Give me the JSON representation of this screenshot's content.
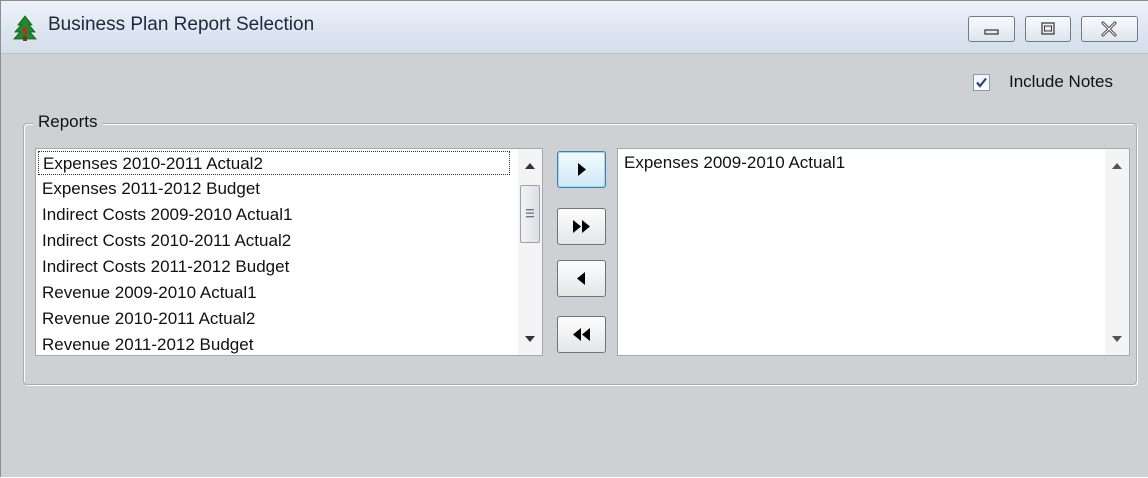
{
  "window": {
    "title": "Business Plan Report Selection",
    "icon": "tree-dollar-icon",
    "caption_buttons": [
      "minimize-icon",
      "restore-icon",
      "close-icon"
    ]
  },
  "options": {
    "include_notes_label": "Include Notes",
    "include_notes_checked": true
  },
  "reports_group": {
    "label": "Reports",
    "available": [
      "Expenses  2010-2011 Actual2",
      "Expenses  2011-2012 Budget",
      "Indirect Costs  2009-2010 Actual1",
      "Indirect Costs  2010-2011 Actual2",
      "Indirect Costs  2011-2012 Budget",
      "Revenue  2009-2010 Actual1",
      "Revenue  2010-2011 Actual2",
      "Revenue  2011-2012 Budget"
    ],
    "selected": [
      "Expenses  2009-2010 Actual1"
    ],
    "move_buttons": [
      "move-right-icon",
      "move-all-right-icon",
      "move-left-icon",
      "move-all-left-icon"
    ]
  },
  "colors": {
    "window_bg": "#cfd0d3",
    "titlebar": "#dde6f1",
    "default_button": "#cfe8f8"
  }
}
